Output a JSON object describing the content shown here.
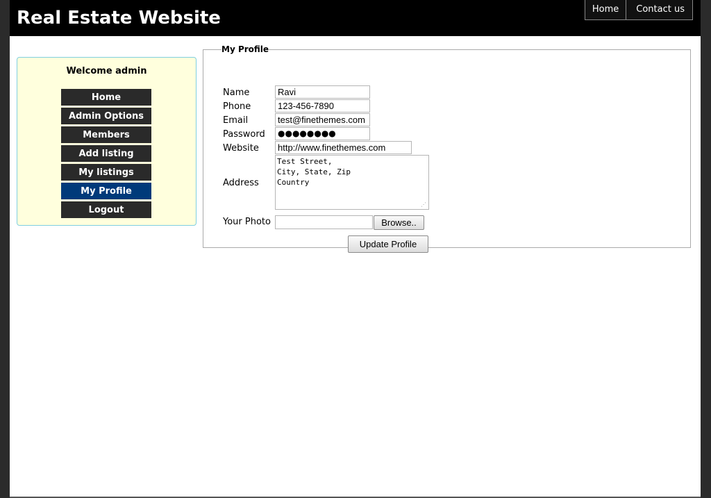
{
  "header": {
    "title": "Real Estate Website",
    "nav": [
      {
        "label": "Home"
      },
      {
        "label": "Contact us"
      }
    ]
  },
  "sidebar": {
    "welcome": "Welcome admin",
    "items": [
      {
        "label": "Home"
      },
      {
        "label": "Admin Options"
      },
      {
        "label": "Members"
      },
      {
        "label": "Add listing"
      },
      {
        "label": "My listings"
      },
      {
        "label": "My Profile"
      },
      {
        "label": "Logout"
      }
    ],
    "active": "My Profile"
  },
  "profile": {
    "legend": "My Profile",
    "name_label": "Name",
    "name_value": "Ravi",
    "phone_label": "Phone",
    "phone_value": "123-456-7890",
    "email_label": "Email",
    "email_value": "test@finethemes.com",
    "password_label": "Password",
    "password_mask": "●●●●●●●●",
    "website_label": "Website",
    "website_value": "http://www.finethemes.com",
    "address_label": "Address",
    "address_value": "Test Street,\nCity, State, Zip\nCountry",
    "photo_label": "Your Photo",
    "photo_value": "",
    "browse_label": "Browse..",
    "submit_label": "Update Profile"
  },
  "colors": {
    "header_bg": "#000000",
    "sidebar_bg": "#ffffdd",
    "sidebar_border": "#7fcfe0",
    "menu_bg": "#2a2a2a",
    "menu_active_bg": "#003a7a"
  }
}
